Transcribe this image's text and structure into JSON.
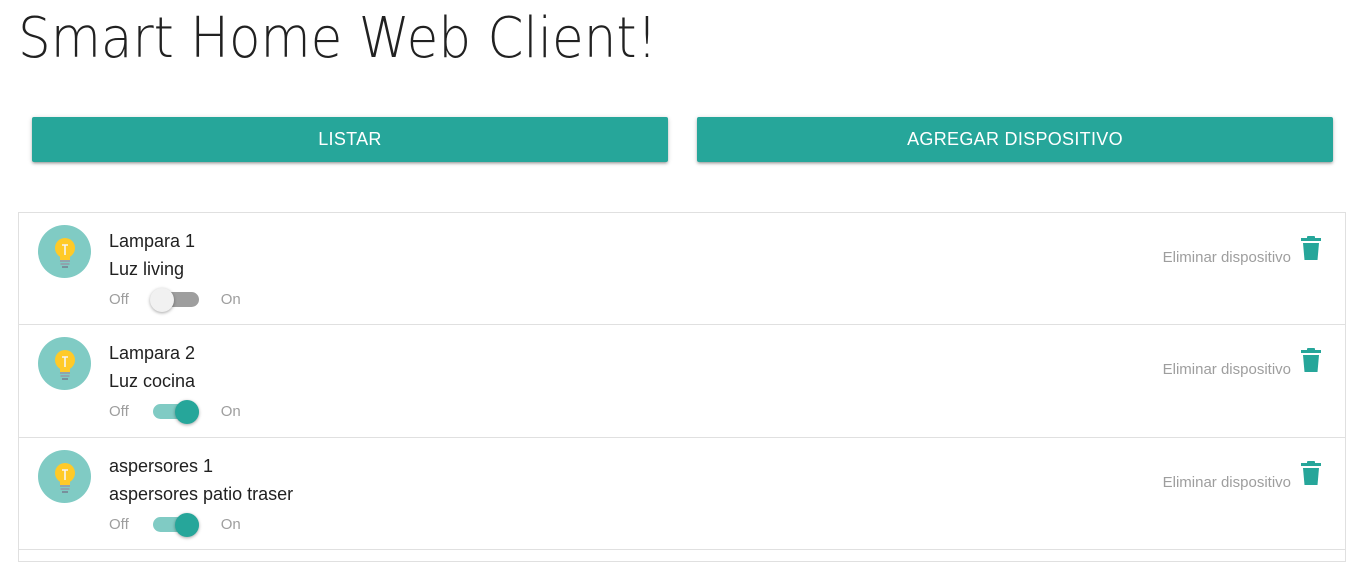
{
  "page": {
    "title": "Smart Home Web Client!"
  },
  "actions": {
    "list_label": "LISTAR",
    "add_label": "AGREGAR DISPOSITIVO"
  },
  "colors": {
    "accent": "#26a69a",
    "avatar_bg": "#80cbc4",
    "bulb": "#ffca28",
    "text_muted": "#9e9e9e"
  },
  "devices": [
    {
      "name": "Lampara 1",
      "description": "Luz living",
      "off_label": "Off",
      "on_label": "On",
      "state": "off",
      "delete_label": "Eliminar dispositivo",
      "icon": "lightbulb-icon"
    },
    {
      "name": "Lampara 2",
      "description": "Luz cocina",
      "off_label": "Off",
      "on_label": "On",
      "state": "on",
      "delete_label": "Eliminar dispositivo",
      "icon": "lightbulb-icon"
    },
    {
      "name": "aspersores 1",
      "description": "aspersores patio traser",
      "off_label": "Off",
      "on_label": "On",
      "state": "on",
      "delete_label": "Eliminar dispositivo",
      "icon": "lightbulb-icon"
    }
  ]
}
